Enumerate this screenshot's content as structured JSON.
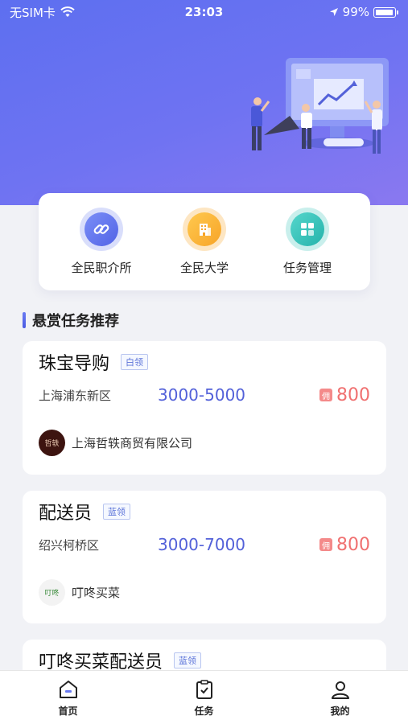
{
  "status_bar": {
    "carrier": "无SIM卡",
    "time": "23:03",
    "battery": "99%"
  },
  "quick_menu": [
    {
      "label": "全民职介所",
      "icon": "link-icon"
    },
    {
      "label": "全民大学",
      "icon": "building-icon"
    },
    {
      "label": "任务管理",
      "icon": "grid-icon"
    }
  ],
  "section": {
    "title": "悬赏任务推荐"
  },
  "jobs": [
    {
      "title": "珠宝导购",
      "tag": "白领",
      "location": "上海浦东新区",
      "salary": "3000-5000",
      "reward_badge": "佣",
      "reward": "800",
      "company_logo_text": "哲轶",
      "company": "上海哲轶商贸有限公司"
    },
    {
      "title": "配送员",
      "tag": "蓝领",
      "location": "绍兴柯桥区",
      "salary": "3000-7000",
      "reward_badge": "佣",
      "reward": "800",
      "company_logo_text": "叮咚",
      "company": "叮咚买菜"
    },
    {
      "title": "叮咚买菜配送员",
      "tag": "蓝领"
    }
  ],
  "tabbar": [
    {
      "label": "首页",
      "icon": "home-icon"
    },
    {
      "label": "任务",
      "icon": "clipboard-icon"
    },
    {
      "label": "我的",
      "icon": "user-icon"
    }
  ],
  "colors": {
    "hero_start": "#5d6ff0",
    "hero_end": "#8a78f0",
    "salary": "#5361d9",
    "reward": "#f07070"
  }
}
